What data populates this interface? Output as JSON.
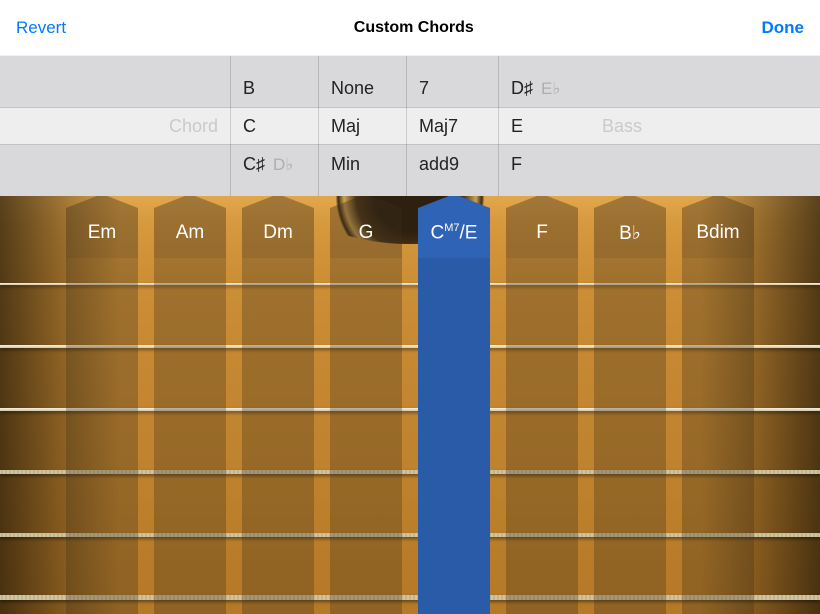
{
  "header": {
    "revert": "Revert",
    "title": "Custom Chords",
    "done": "Done"
  },
  "picker": {
    "label_left": "Chord",
    "label_right": "Bass",
    "cols": {
      "root": {
        "prev": "B",
        "sel": "C",
        "next": "C♯",
        "next_enh": "D♭"
      },
      "quality": {
        "prev": "None",
        "sel": "Maj",
        "next": "Min"
      },
      "extension": {
        "prev": "7",
        "sel": "Maj7",
        "next": "add9"
      },
      "bass": {
        "prev": "D♯",
        "prev_enh": "E♭",
        "sel": "E",
        "next": "F"
      }
    }
  },
  "strips": [
    {
      "label": "Em",
      "active": false
    },
    {
      "label": "Am",
      "active": false
    },
    {
      "label": "Dm",
      "active": false
    },
    {
      "label": "G",
      "active": false
    },
    {
      "label_html": "C<sup>M7</sup>/E",
      "label": "CM7/E",
      "active": true
    },
    {
      "label": "F",
      "active": false
    },
    {
      "label": "B♭",
      "active": false
    },
    {
      "label": "Bdim",
      "active": false
    }
  ]
}
